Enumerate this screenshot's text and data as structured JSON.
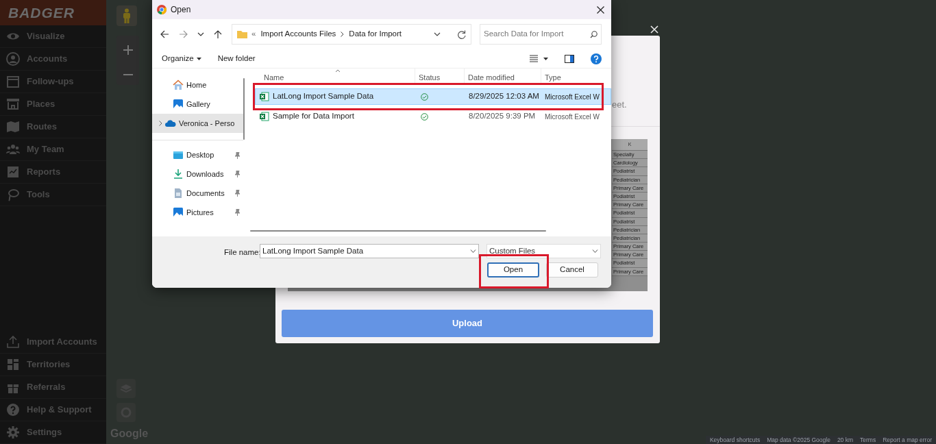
{
  "sidebar": {
    "logo": "BADGER",
    "items": [
      {
        "label": "Visualize"
      },
      {
        "label": "Accounts"
      },
      {
        "label": "Follow-ups"
      },
      {
        "label": "Places"
      },
      {
        "label": "Routes"
      },
      {
        "label": "My Team"
      },
      {
        "label": "Reports"
      },
      {
        "label": "Tools"
      }
    ],
    "bottom_items": [
      {
        "label": "Import Accounts"
      },
      {
        "label": "Territories"
      },
      {
        "label": "Referrals"
      },
      {
        "label": "Help & Support"
      },
      {
        "label": "Settings"
      }
    ]
  },
  "map": {
    "logo": "Google",
    "footer": [
      "Keyboard shortcuts",
      "Map data ©2025 Google",
      "20 km",
      "Terms",
      "Report a map error"
    ]
  },
  "upload_modal": {
    "text": "eet.",
    "sheet": {
      "column": "K",
      "cells": [
        "Specialty",
        "Cardiology",
        "Podiatrist",
        "Pediatrician",
        "Primary Care",
        "Podiatrist",
        "Primary Care",
        "Podiatrist",
        "Podiatrist",
        "Pediatrician",
        "Pediatrician",
        "Primary Care",
        "Primary Care",
        "Podiatrist",
        "Primary Care"
      ]
    },
    "button": "Upload"
  },
  "open_dialog": {
    "title": "Open",
    "breadcrumb": [
      "«",
      "Import Accounts Files",
      "Data for Import"
    ],
    "search": {
      "placeholder": "Search Data for Import"
    },
    "toolbar": {
      "organize": "Organize",
      "new_folder": "New folder"
    },
    "nav": [
      {
        "label": "Home",
        "pinned": false,
        "selected": false,
        "divider_before": false
      },
      {
        "label": "Gallery",
        "pinned": false,
        "selected": false,
        "divider_before": false
      },
      {
        "label": "Veronica - Perso",
        "pinned": false,
        "selected": true,
        "divider_before": false
      },
      {
        "label": "Desktop",
        "pinned": true,
        "selected": false,
        "divider_before": true
      },
      {
        "label": "Downloads",
        "pinned": true,
        "selected": false,
        "divider_before": false
      },
      {
        "label": "Documents",
        "pinned": true,
        "selected": false,
        "divider_before": false
      },
      {
        "label": "Pictures",
        "pinned": true,
        "selected": false,
        "divider_before": false
      }
    ],
    "columns": [
      "Name",
      "Status",
      "Date modified",
      "Type"
    ],
    "files": [
      {
        "name": "LatLong Import Sample Data",
        "date": "8/29/2025 12:03 AM",
        "type": "Microsoft Excel W",
        "selected": true,
        "highlighted": true
      },
      {
        "name": "Sample for Data Import",
        "date": "8/20/2025 9:39 PM",
        "type": "Microsoft Excel W",
        "selected": false,
        "highlighted": false
      }
    ],
    "file_name_label": "File name:",
    "file_name": "LatLong Import Sample Data",
    "file_type": "Custom Files",
    "buttons": [
      {
        "label": "Open",
        "primary": true,
        "highlighted": true
      },
      {
        "label": "Cancel",
        "primary": false,
        "highlighted": false
      }
    ]
  }
}
